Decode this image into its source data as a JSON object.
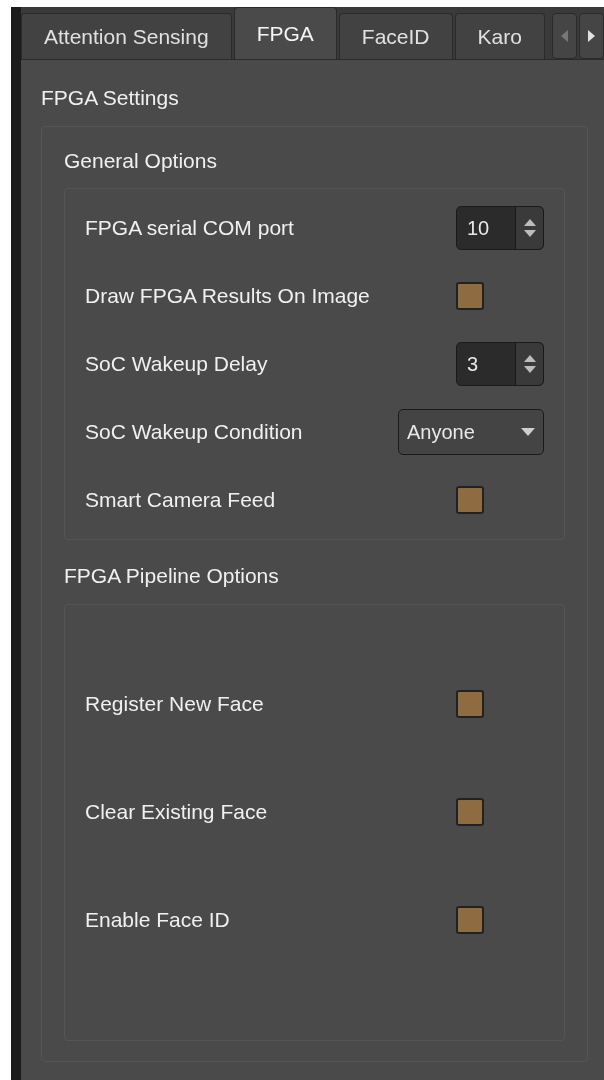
{
  "tabs": [
    {
      "label": "Attention Sensing",
      "selected": false
    },
    {
      "label": "FPGA",
      "selected": true
    },
    {
      "label": "FaceID",
      "selected": false
    },
    {
      "label": "Karo",
      "selected": false
    }
  ],
  "settings": {
    "title": "FPGA Settings",
    "groups": [
      {
        "title": "General Options",
        "rows": [
          {
            "kind": "spin",
            "label": "FPGA serial COM port",
            "value": "10"
          },
          {
            "kind": "check",
            "label": "Draw FPGA Results On Image",
            "checked": false
          },
          {
            "kind": "spin",
            "label": "SoC Wakeup Delay",
            "value": "3"
          },
          {
            "kind": "combo",
            "label": "SoC Wakeup Condition",
            "value": "Anyone"
          },
          {
            "kind": "check",
            "label": "Smart Camera Feed",
            "checked": false
          }
        ]
      },
      {
        "title": "FPGA Pipeline Options",
        "rows": [
          {
            "kind": "check",
            "label": "Register New Face",
            "checked": false
          },
          {
            "kind": "check",
            "label": "Clear Existing Face",
            "checked": false
          },
          {
            "kind": "check",
            "label": "Enable Face ID",
            "checked": false
          }
        ]
      }
    ]
  }
}
